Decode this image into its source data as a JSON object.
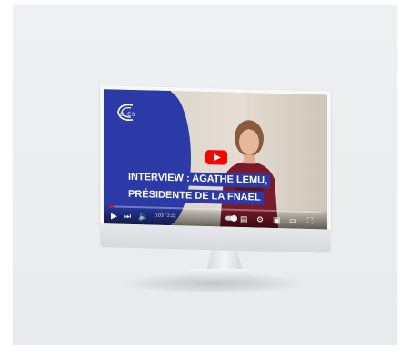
{
  "colors": {
    "accent_blue": "#2b3aa7",
    "youtube_red": "#ff0000",
    "background": "#eceef0"
  },
  "logo": {
    "text": "CLÉS",
    "icon": "cles-logo-icon"
  },
  "video": {
    "headline_line1": "INTERVIEW : AGATHE LEMU,",
    "headline_line2": "PRÉSIDENTE DE LA FNAEL",
    "play_icon": "play-icon"
  },
  "player": {
    "time": "0:03 / 2:22",
    "progress_fraction": 0.02,
    "icons": [
      "play-icon",
      "next-icon",
      "volume-icon",
      "autoplay-toggle",
      "subtitles-icon",
      "settings-icon",
      "miniplayer-icon",
      "theater-icon",
      "fullscreen-icon"
    ]
  }
}
